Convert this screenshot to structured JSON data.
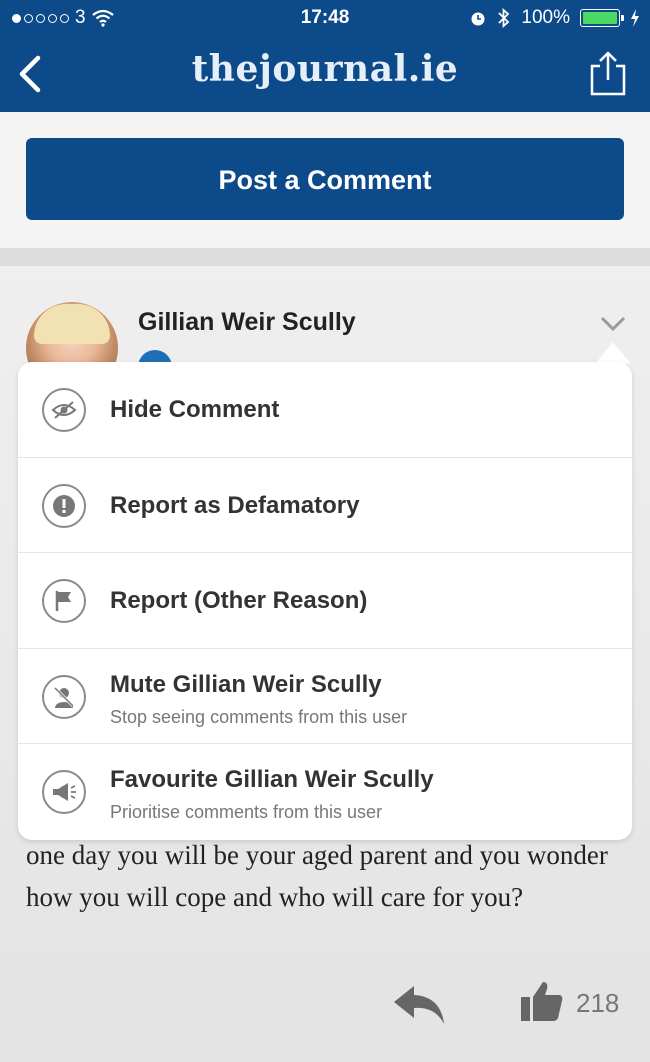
{
  "status_bar": {
    "carrier": "3",
    "time": "17:48",
    "battery": "100%"
  },
  "nav": {
    "logo": "thejournal.ie"
  },
  "post_button": {
    "label": "Post a Comment"
  },
  "comment": {
    "author": "Gillian Weir Scully",
    "text": "one day you will be your aged parent and you wonder how you will cope and who will care for you?",
    "likes": "218"
  },
  "menu": {
    "items": [
      {
        "label": "Hide Comment",
        "sub": "",
        "icon": "hide-eye-icon"
      },
      {
        "label": "Report as Defamatory",
        "sub": "",
        "icon": "exclamation-icon"
      },
      {
        "label": "Report (Other Reason)",
        "sub": "",
        "icon": "flag-icon"
      },
      {
        "label": "Mute Gillian Weir Scully",
        "sub": "Stop seeing comments from this user",
        "icon": "mute-user-icon"
      },
      {
        "label": "Favourite Gillian Weir Scully",
        "sub": "Prioritise comments from this user",
        "icon": "megaphone-icon"
      }
    ]
  },
  "colors": {
    "brand_blue": "#0d4a8a",
    "battery_green": "#4cd964"
  }
}
